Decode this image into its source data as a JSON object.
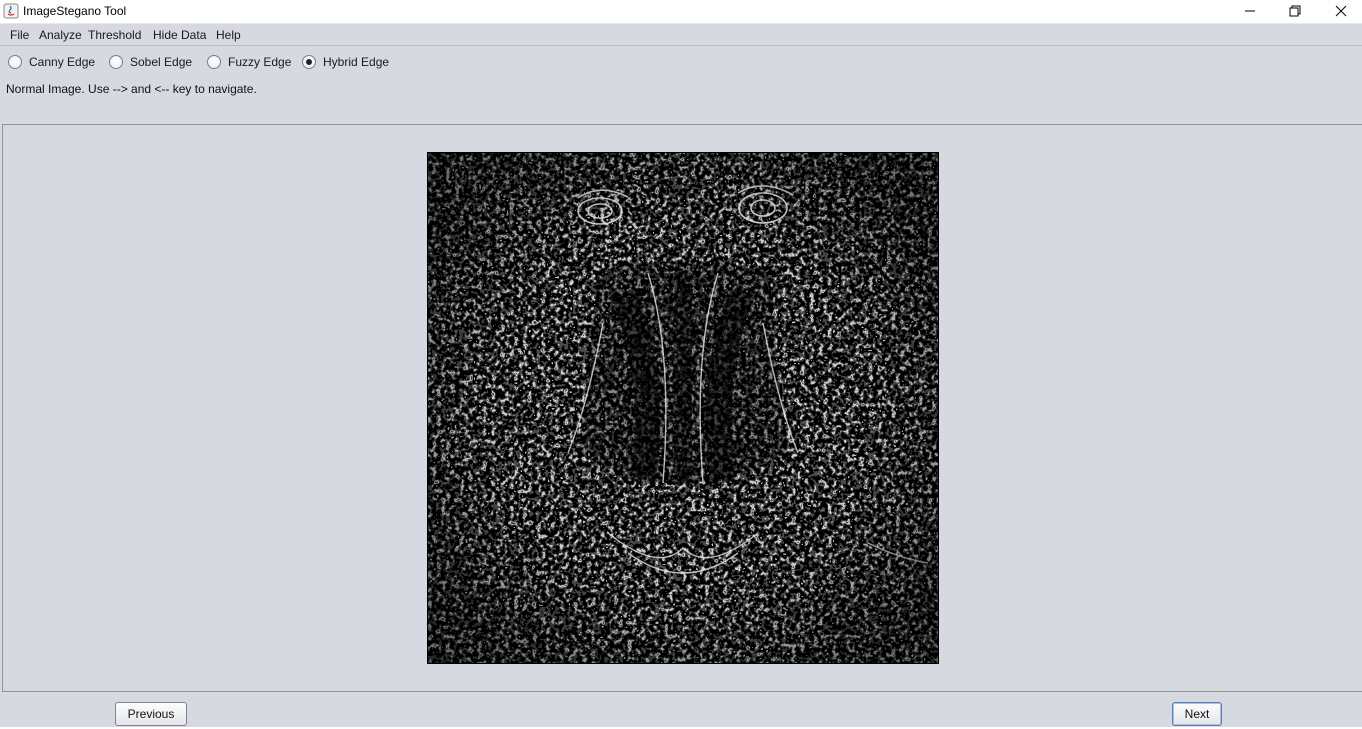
{
  "window": {
    "title": "ImageStegano Tool"
  },
  "menu": {
    "items": [
      "File",
      "Analyze",
      "Threshold",
      "Hide Data",
      "Help"
    ]
  },
  "edge_options": [
    {
      "label": "Canny Edge",
      "checked": false
    },
    {
      "label": "Sobel Edge",
      "checked": false
    },
    {
      "label": "Fuzzy Edge",
      "checked": false
    },
    {
      "label": "Hybrid Edge",
      "checked": true
    }
  ],
  "status": {
    "text": "Normal Image. Use --> and <-- key to navigate."
  },
  "image": {
    "description_icon": "edge-detected-image"
  },
  "buttons": {
    "previous": "Previous",
    "next": "Next"
  },
  "colors": {
    "background": "#d6d9df",
    "titlebar": "#ffffff",
    "image_bg": "#000000",
    "edge_line": "#e8e8e8"
  }
}
